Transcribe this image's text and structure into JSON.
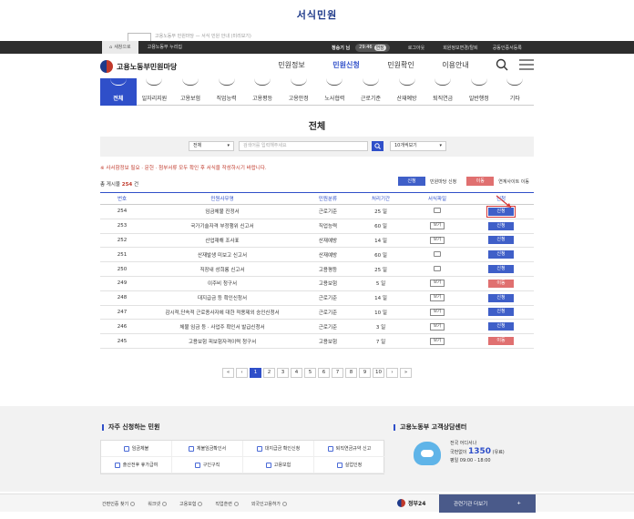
{
  "page_title": "서식민원",
  "ghost_text": "고용노동부 민원마당 — 서식 민원 안내 (미리보기)",
  "topbar": {
    "home": "새창으로",
    "site": "고용노동부 누리집",
    "user": "정승기 님",
    "timer": "29:46",
    "extend": "연장",
    "logout": "로그아웃",
    "join": "회원정보변경/탈퇴",
    "sitemap": "공동인증서등록"
  },
  "header": {
    "logo": "고용노동부민원마당",
    "nav": [
      "민원정보",
      "민원신청",
      "민원확인",
      "이용안내"
    ],
    "nav_active": 1
  },
  "categories": [
    "전체",
    "일자리지원",
    "고용보험",
    "직업능력",
    "고용평등",
    "고용안정",
    "노사협력",
    "근로기준",
    "산재예방",
    "퇴직연금",
    "일반행정",
    "기타"
  ],
  "section_title": "전체",
  "search": {
    "field_select": "전체",
    "placeholder": "검색어를 입력해주세요",
    "page_size": "10개씩보기"
  },
  "notice": "※ 사서함정보 필요 · 문헌 · 첨부서류 모두 확인 후 서식을 작성하시기 바랍니다.",
  "count_label": "총 게시물",
  "count_value": "254",
  "count_unit": "건",
  "legend": {
    "apply": "신청",
    "apply_desc": "민원마당 신청",
    "link": "이동",
    "link_desc": "연계사이트 이동"
  },
  "table": {
    "headers": [
      "번호",
      "민원사무명",
      "민원분류",
      "처리기간",
      "서식파일",
      "신청"
    ],
    "rows": [
      {
        "no": "254",
        "name": "임금체불 진정서",
        "dept": "근로기준",
        "days": "25 일",
        "form": "icon",
        "apply": "신청",
        "kind": "blue"
      },
      {
        "no": "253",
        "name": "국가기술자격 부정행위 신고서",
        "dept": "직업능력",
        "days": "60 일",
        "form": "보기",
        "apply": "신청",
        "kind": "blue"
      },
      {
        "no": "252",
        "name": "산업재해 조사표",
        "dept": "산재예방",
        "days": "14 일",
        "form": "보기",
        "apply": "신청",
        "kind": "blue"
      },
      {
        "no": "251",
        "name": "산재발생 미보고 신고서",
        "dept": "산재예방",
        "days": "60 일",
        "form": "icon",
        "apply": "신청",
        "kind": "blue"
      },
      {
        "no": "250",
        "name": "직장내 성희롱 신고서",
        "dept": "고용평등",
        "days": "25 일",
        "form": "icon",
        "apply": "신청",
        "kind": "blue"
      },
      {
        "no": "249",
        "name": "이주비 청구서",
        "dept": "고용보험",
        "days": "5 일",
        "form": "보기",
        "apply": "이동",
        "kind": "red"
      },
      {
        "no": "248",
        "name": "대지급금 등 확인신청서",
        "dept": "근로기준",
        "days": "14 일",
        "form": "보기",
        "apply": "신청",
        "kind": "blue"
      },
      {
        "no": "247",
        "name": "감시적,단속적 근로종사자에 대한 적용제외 승인신청서",
        "dept": "근로기준",
        "days": "10 일",
        "form": "보기",
        "apply": "신청",
        "kind": "blue"
      },
      {
        "no": "246",
        "name": "체불 임금 등 · 사업주 확인서 발급신청서",
        "dept": "근로기준",
        "days": "3 일",
        "form": "보기",
        "apply": "신청",
        "kind": "blue"
      },
      {
        "no": "245",
        "name": "고용보험 피보험자격이력 청구서",
        "dept": "고용보험",
        "days": "7 일",
        "form": "보기",
        "apply": "이동",
        "kind": "red"
      }
    ]
  },
  "pager": {
    "first": "«",
    "prev": "‹",
    "pages": [
      "1",
      "2",
      "3",
      "4",
      "5",
      "6",
      "7",
      "8",
      "9",
      "10"
    ],
    "active": 0,
    "next": "›",
    "last": "»"
  },
  "frequent": {
    "title": "자주 신청하는 민원",
    "items": [
      "임금체불",
      "체불임금확인서",
      "대지급금 확인신청",
      "퇴직연금규약 신고",
      "출산전후 휴가급여",
      "구인구직",
      "고용보험",
      "실업인정"
    ]
  },
  "call_center": {
    "title": "고용노동부 고객상담센터",
    "line1": "전국 어디서나",
    "line2_prefix": "국번없이",
    "number": "1350",
    "line2_suffix": "(유료)",
    "hours": "평일 09:00 - 18:00"
  },
  "bottom": {
    "links": [
      "간편인증 찾기",
      "워크넷",
      "고용보험",
      "직업훈련",
      "외국인고용허가"
    ],
    "gov24": "정부24",
    "related": "관련기관 더보기",
    "plus": "+"
  }
}
